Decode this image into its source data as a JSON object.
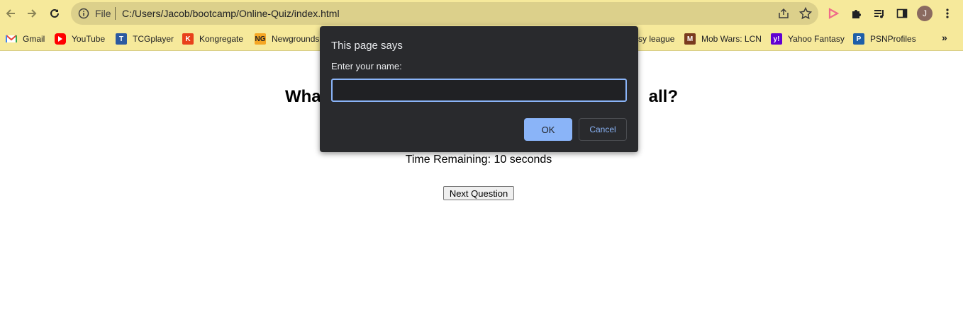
{
  "browser": {
    "url_scheme": "File",
    "url": "C:/Users/Jacob/bootcamp/Online-Quiz/index.html",
    "profile_initial": "J",
    "icons": {
      "back": "back-arrow-icon",
      "forward": "forward-arrow-icon",
      "reload": "reload-icon",
      "info": "info-icon",
      "share": "share-icon",
      "star": "bookmark-star-icon",
      "extension": "puzzle-icon",
      "media": "media-queue-icon",
      "side_panel": "side-panel-icon",
      "menu": "kebab-menu-icon"
    },
    "colors": {
      "toolbar": "#f6e99b",
      "omnibox": "#dcd08b"
    }
  },
  "bookmarks": {
    "items": [
      {
        "label": "Gmail",
        "icon": "gmail-icon",
        "color": "#ea4335"
      },
      {
        "label": "YouTube",
        "icon": "youtube-icon",
        "color": "#ff0000"
      },
      {
        "label": "TCGplayer",
        "icon": "tcgplayer-icon",
        "color": "#2c5aa0"
      },
      {
        "label": "Kongregate",
        "icon": "kongregate-icon",
        "color": "#e8411b"
      },
      {
        "label": "Newgrounds",
        "icon": "newgrounds-icon",
        "color": "#f5a623"
      },
      {
        "label": "sy league",
        "icon": "",
        "color": ""
      },
      {
        "label": "Mob Wars: LCN",
        "icon": "mobwars-icon",
        "color": "#7a3b1e"
      },
      {
        "label": "Yahoo Fantasy",
        "icon": "yahoo-icon",
        "color": "#6001d2"
      },
      {
        "label": "PSNProfiles",
        "icon": "psnprofiles-icon",
        "color": "#1e5fa8"
      }
    ],
    "more": "»"
  },
  "page": {
    "question_left": "Wha",
    "question_right": "all?",
    "timer": "Time Remaining: 10 seconds",
    "next_button": "Next Question"
  },
  "dialog": {
    "title": "This page says",
    "prompt": "Enter your name:",
    "input_value": "",
    "ok_label": "OK",
    "cancel_label": "Cancel",
    "accent": "#8ab4f8"
  }
}
